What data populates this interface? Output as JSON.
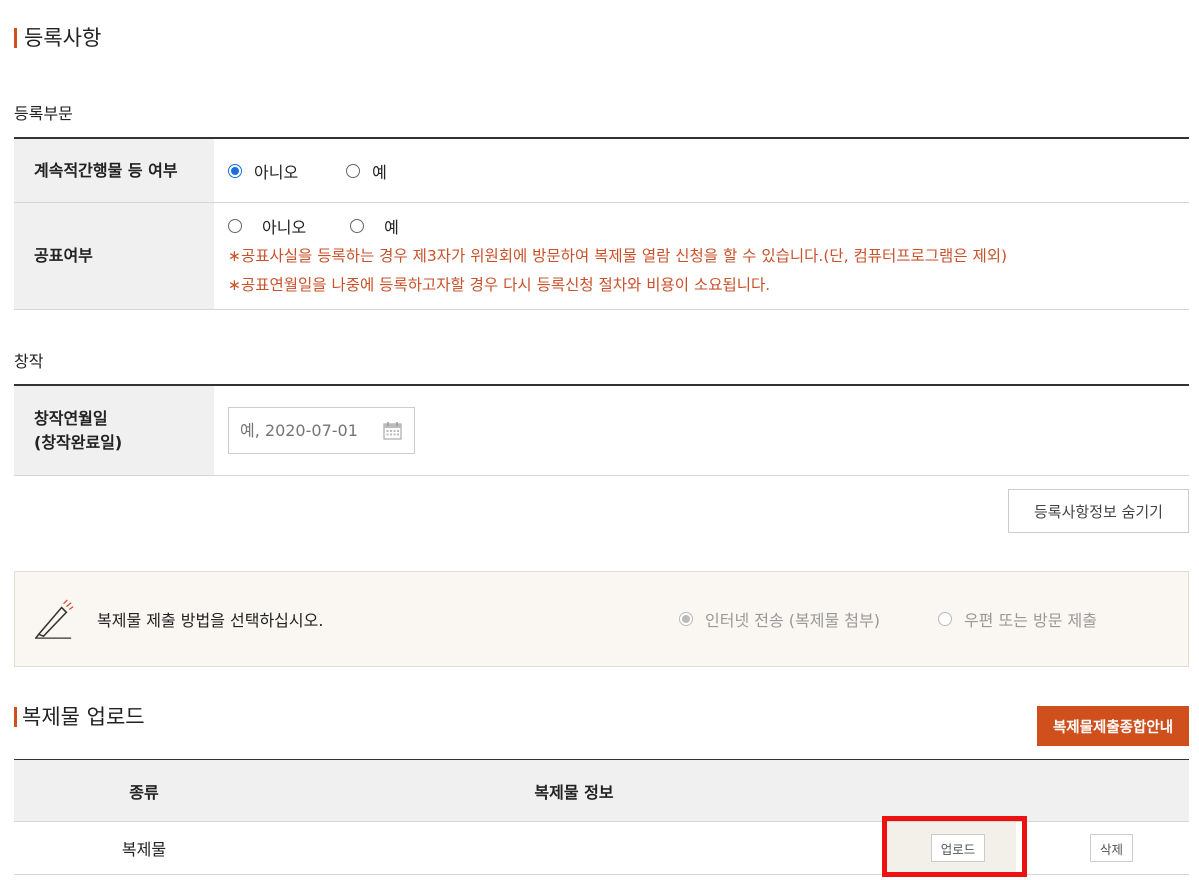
{
  "registration": {
    "title": "등록사항",
    "category_title": "등록부문",
    "serial_label": "계속적간행물 등 여부",
    "serial_options": [
      "아니오",
      "예"
    ],
    "serial_selected": "아니오",
    "publish_label": "공표여부",
    "publish_options": [
      "아니오",
      "예"
    ],
    "notice1": "∗공표사실을 등록하는 경우 제3자가 위원회에 방문하여 복제물 열람 신청을 할 수 있습니다.(단, 컴퓨터프로그램은 제외)",
    "notice2": "∗공표연월일을 나중에 등록하고자할 경우 다시 등록신청 절차와 비용이 소요됩니다."
  },
  "creation": {
    "title": "창작",
    "date_label_line1": "창작연월일",
    "date_label_line2": "(창작완료일)",
    "date_placeholder": "예, 2020-07-01"
  },
  "hide_button": "등록사항정보 숨기기",
  "method": {
    "prompt": "복제물 제출 방법을 선택하십시오.",
    "option_internet": "인터넷 전송 (복제물 첨부)",
    "option_post": "우편 또는 방문 제출"
  },
  "upload": {
    "title": "복제물 업로드",
    "guide_button": "복제물제출종합안내",
    "col_type": "종류",
    "col_info": "복제물 정보",
    "row_type": "복제물",
    "upload_button": "업로드",
    "delete_button": "삭제"
  },
  "colors": {
    "accent": "#cf4f1d",
    "notice": "#c9522a",
    "highlight": "#ee1111"
  }
}
